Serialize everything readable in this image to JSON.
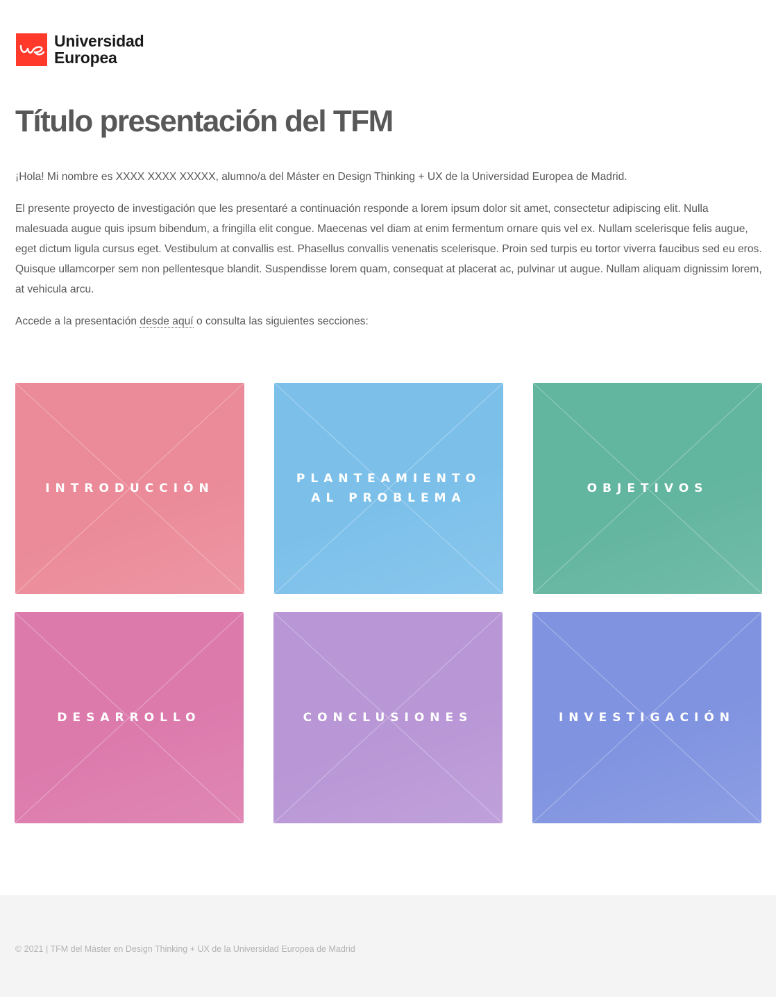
{
  "brand": {
    "line1": "Universidad",
    "line2": "Europea",
    "logo_color": "#ff3a2b"
  },
  "title": "Título presentación del TFM",
  "intro": {
    "greeting": "¡Hola! Mi nombre es XXXX XXXX XXXXX, alumno/a del Máster en Design Thinking + UX de la Universidad Europea de Madrid.",
    "body": "El presente proyecto de investigación que les presentaré a continuación responde a lorem ipsum dolor sit amet, consectetur adipiscing elit. Nulla malesuada augue quis ipsum bibendum, a fringilla elit congue. Maecenas vel diam at enim fermentum ornare quis vel ex. Nullam scelerisque felis augue, eget dictum ligula cursus eget. Vestibulum at convallis est. Phasellus convallis venenatis scelerisque. Proin sed turpis eu tortor viverra faucibus sed eu eros. Quisque ullamcorper sem non pellentesque blandit. Suspendisse lorem quam, consequat at placerat ac, pulvinar ut augue. Nullam aliquam dignissim lorem, at vehicula arcu.",
    "access_before": "Accede a la presentación ",
    "access_link": "desde aquí",
    "access_after": " o consulta las siguientes secciones:"
  },
  "tiles": [
    {
      "label": "INTRODUCCIÓN",
      "color": "#eb8a99"
    },
    {
      "label": "PLANTEAMIENTO AL PROBLEMA",
      "color": "#7cc0ea"
    },
    {
      "label": "OBJETIVOS",
      "color": "#62b59f"
    },
    {
      "label": "DESARROLLO",
      "color": "#dc7aac"
    },
    {
      "label": "CONCLUSIONES",
      "color": "#b996d6"
    },
    {
      "label": "INVESTIGACIÓN",
      "color": "#8093e0"
    }
  ],
  "footer": "© 2021 | TFM del Máster en Design Thinking + UX de la Universidad Europea de Madrid"
}
